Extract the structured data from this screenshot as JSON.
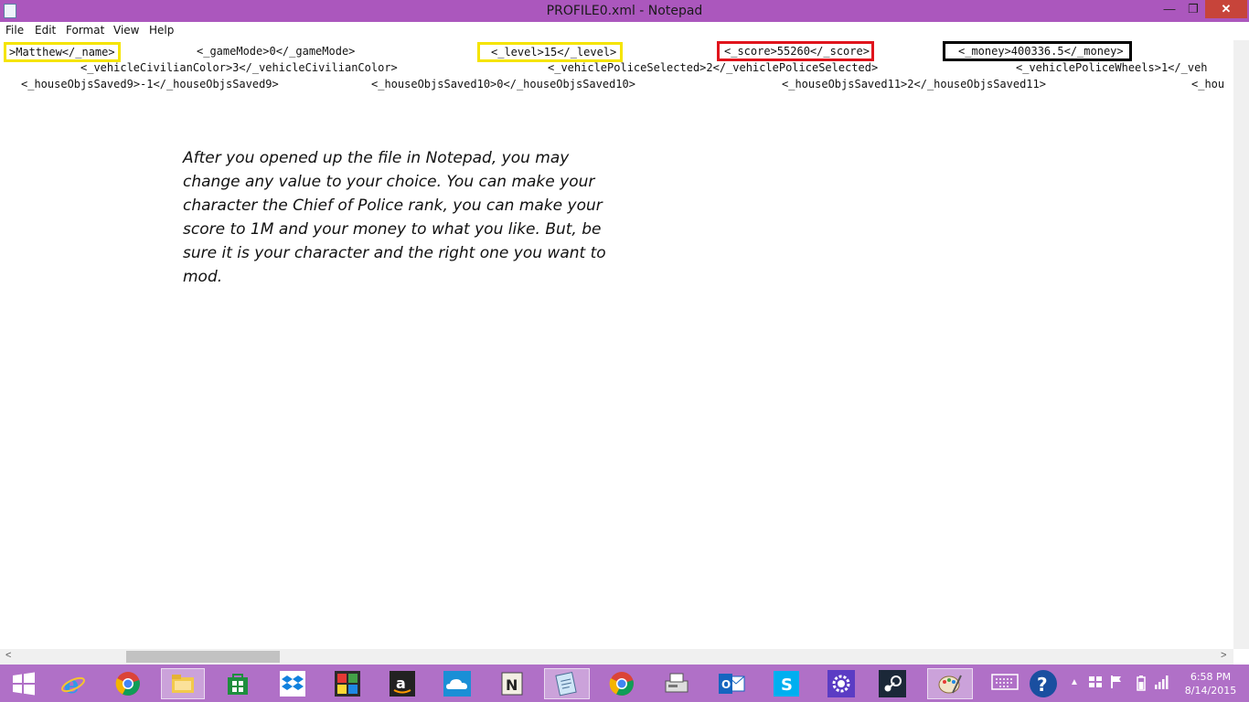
{
  "window": {
    "title": "PROFILE0.xml - Notepad",
    "minimize": "—",
    "maximize": "❐",
    "close": "✕"
  },
  "menu": [
    "File",
    "Edit",
    "Format",
    "View",
    "Help"
  ],
  "lines": {
    "l1": [
      ">Matthew</_name>",
      "<_gameMode>0</_gameMode>",
      "<_level>15</_level>",
      "<_score>55260</_score>",
      "<_money>400336.5</_money>"
    ],
    "l2": [
      "<_vehicleCivilianColor>3</_vehicleCivilianColor>",
      "<_vehiclePoliceSelected>2</_vehiclePoliceSelected>",
      "<_vehiclePoliceWheels>1</_veh"
    ],
    "l3": [
      "<_houseObjsSaved9>-1</_houseObjsSaved9>",
      "<_houseObjsSaved10>0</_houseObjsSaved10>",
      "<_houseObjsSaved11>2</_houseObjsSaved11>",
      "<_hou"
    ]
  },
  "highlights": {
    "name": "#f5e400",
    "level": "#f5e400",
    "score": "#e0141c",
    "money": "#000000"
  },
  "note": "After you opened up the file in Notepad, you may change any value to your choice. You can make your character the Chief of Police rank, you can make your score to 1M and your money to what you like. But, be sure it is your character and the right one you want to mod.",
  "scroll": {
    "left": "<",
    "right": ">"
  },
  "taskbar": {
    "apps": [
      "windows-start",
      "internet-explorer",
      "chrome",
      "file-explorer",
      "windows-store",
      "dropbox",
      "puzzle-app",
      "amazon",
      "onedrive",
      "notepad-plus",
      "notepad",
      "chrome",
      "fax-printer",
      "outlook",
      "skype",
      "settings",
      "steam",
      "paint"
    ],
    "time": "6:58 PM",
    "date": "8/14/2015"
  }
}
